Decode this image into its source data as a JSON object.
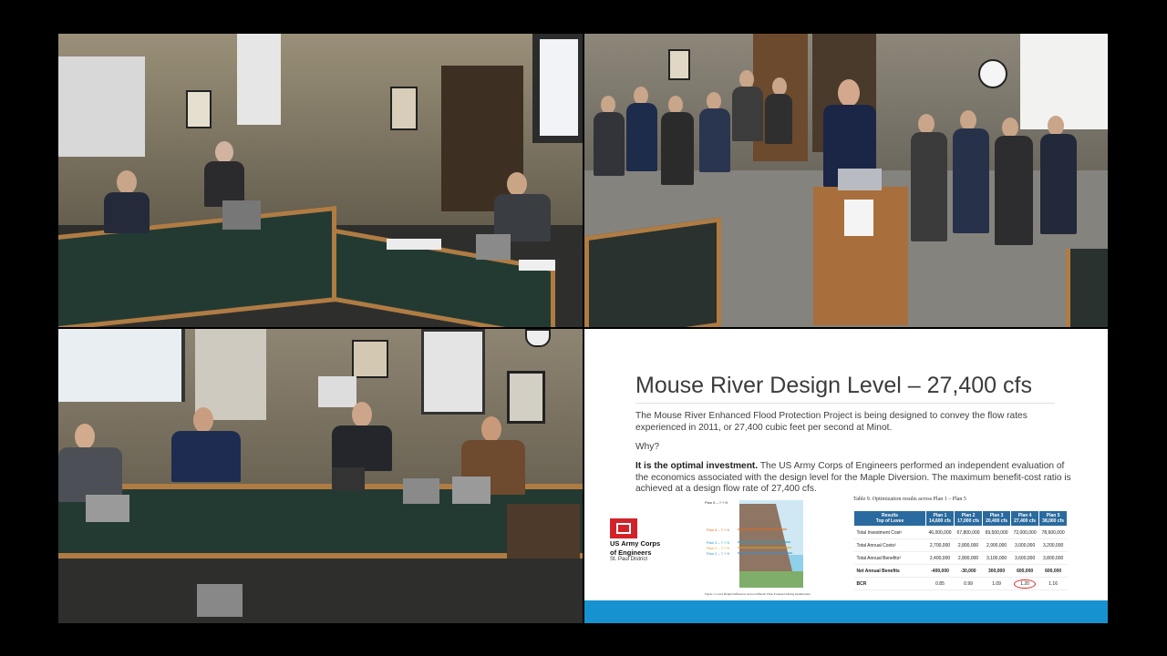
{
  "slide": {
    "title": "Mouse River Design Level – 27,400 cfs",
    "para1": "The Mouse River Enhanced Flood Protection Project is being designed to convey the flow rates experienced in 2011, or 27,400 cubic feet per second at Minot.",
    "why": "Why?",
    "bold_lead": "It is the optimal investment.",
    "para2": " The US Army Corps of Engineers performed an independent evaluation of the economics associated with the design level for the Maple Diversion. The maximum benefit-cost ratio is achieved at a design flow rate of 27,400 cfs.",
    "logo_line1": "US Army Corps",
    "logo_line2": "of Engineers",
    "logo_line3": "St. Paul District",
    "figure_caption": "Figure 1: Levee Height Differences Across Different Plans Evaluated During Optimization",
    "diagram_labels": [
      "Plan 5 – ?.? ft",
      "Plan 4 – ?.? ft",
      "Plan 3 – ?.? ft",
      "Plan 2 – ?.? ft",
      "Plan 1 – ?.? ft"
    ],
    "table_caption": "Table 9. Optimization results across Plan 1 – Plan 5",
    "table": {
      "headers": [
        "Results\nTop of Levee",
        "Plan 1\n14,600 cfs",
        "Plan 2\n17,000 cfs",
        "Plan 3\n20,400 cfs",
        "Plan 4\n27,400 cfs",
        "Plan 5\n38,000 cfs"
      ],
      "rows": [
        [
          "Total Investment Cost¹",
          "46,000,000",
          "67,800,000",
          "69,500,000",
          "72,000,000",
          "78,600,000"
        ],
        [
          "Total Annual Costs²",
          "2,700,000",
          "2,800,000",
          "2,900,000",
          "3,000,000",
          "3,200,000"
        ],
        [
          "Total Annual Benefits³",
          "2,400,000",
          "2,800,000",
          "3,100,000",
          "3,600,000",
          "3,800,000"
        ],
        [
          "Net Annual Benefits",
          "-400,000",
          "-30,000",
          "300,000",
          "600,000",
          "600,000"
        ],
        [
          "BCR",
          "0.85",
          "0.99",
          "1.09",
          "1.20",
          "1.16"
        ]
      ]
    }
  },
  "colors": {
    "slide_accent": "#1592cf",
    "table_header": "#2a6a9e",
    "logo_red": "#d2232a",
    "highlight_circle": "#e02020"
  }
}
